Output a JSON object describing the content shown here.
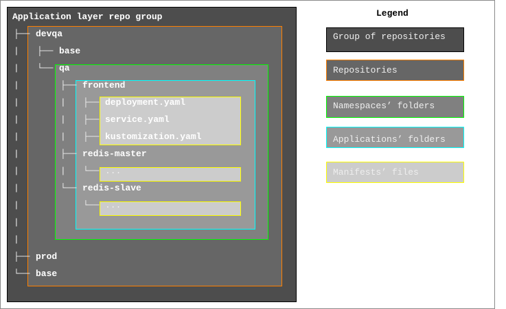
{
  "title": "Application layer repo group",
  "tree": [
    {
      "prefix": "├──",
      "label": "devqa"
    },
    {
      "prefix": "├──",
      "label": "base"
    },
    {
      "prefix": "└──",
      "label": "qa"
    },
    {
      "prefix": "├──",
      "label": "frontend"
    },
    {
      "prefix": "├──",
      "label": "deployment.yaml"
    },
    {
      "prefix": "├──",
      "label": "service.yaml"
    },
    {
      "prefix": "├──",
      "label": "kustomization.yaml"
    },
    {
      "prefix": "├──",
      "label": "redis-master"
    },
    {
      "prefix": "└──",
      "label": "..."
    },
    {
      "prefix": "└──",
      "label": "redis-slave"
    },
    {
      "prefix": "└──",
      "label": "..."
    },
    {
      "prefix": "├──",
      "label": "prod"
    },
    {
      "prefix": "└──",
      "label": "base"
    }
  ],
  "pipe": "|",
  "legend": {
    "title": "Legend",
    "items": [
      {
        "label": "Group of repositories",
        "fill": "#4d4d4d",
        "border": "#000000"
      },
      {
        "label": "Repositories",
        "fill": "#666666",
        "border": "#ff8000"
      },
      {
        "label": "Namespaces’ folders",
        "fill": "#808080",
        "border": "#00ff00"
      },
      {
        "label": "Applications’ folders",
        "fill": "#999999",
        "border": "#00ffff"
      },
      {
        "label": "Manifests’ files",
        "fill": "#cccccc",
        "border": "#ffff00"
      }
    ]
  }
}
